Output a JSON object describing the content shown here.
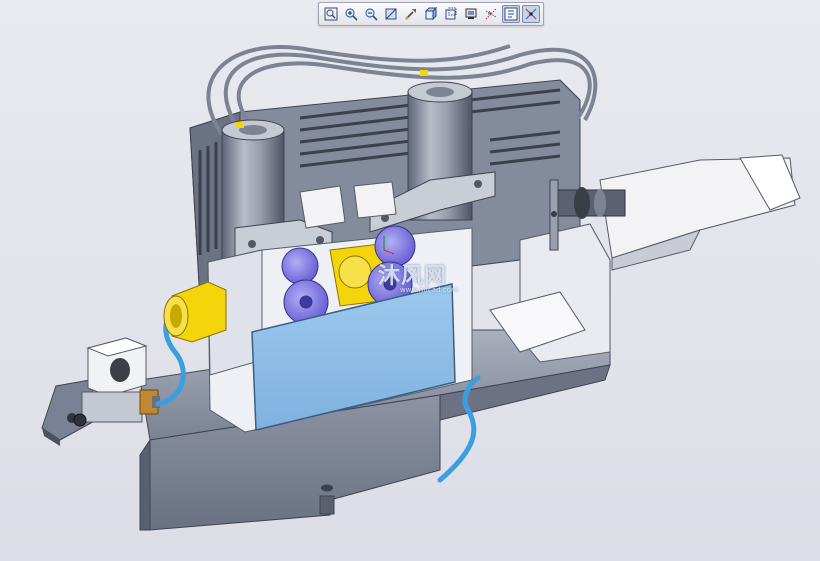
{
  "toolbar": {
    "buttons": [
      {
        "icon": "zoom-fit-icon",
        "tooltip": ""
      },
      {
        "icon": "zoom-in-icon",
        "tooltip": ""
      },
      {
        "icon": "zoom-out-icon",
        "tooltip": ""
      },
      {
        "icon": "view-orient-icon",
        "tooltip": ""
      },
      {
        "icon": "spin-center-icon",
        "tooltip": ""
      },
      {
        "icon": "saved-views-icon",
        "tooltip": ""
      },
      {
        "icon": "display-style-icon",
        "tooltip": ""
      },
      {
        "icon": "layer-icon",
        "tooltip": ""
      },
      {
        "icon": "datum-display-icon",
        "tooltip": ""
      },
      {
        "icon": "annotation-display-icon",
        "tooltip": ""
      },
      {
        "icon": "point-display-icon",
        "tooltip": ""
      }
    ]
  },
  "watermark": {
    "text": "沐风网",
    "sub": "www.mfcad.com"
  },
  "colors": {
    "background": "#e3e4eb",
    "metal": "#8f96a8",
    "metal_dark": "#5c6374",
    "panel_blue": "#8fc0ea",
    "purple": "#8b84e6",
    "yellow": "#f4d40a",
    "hose_blue": "#3a9fe0",
    "white_part": "#f3f3f6"
  }
}
